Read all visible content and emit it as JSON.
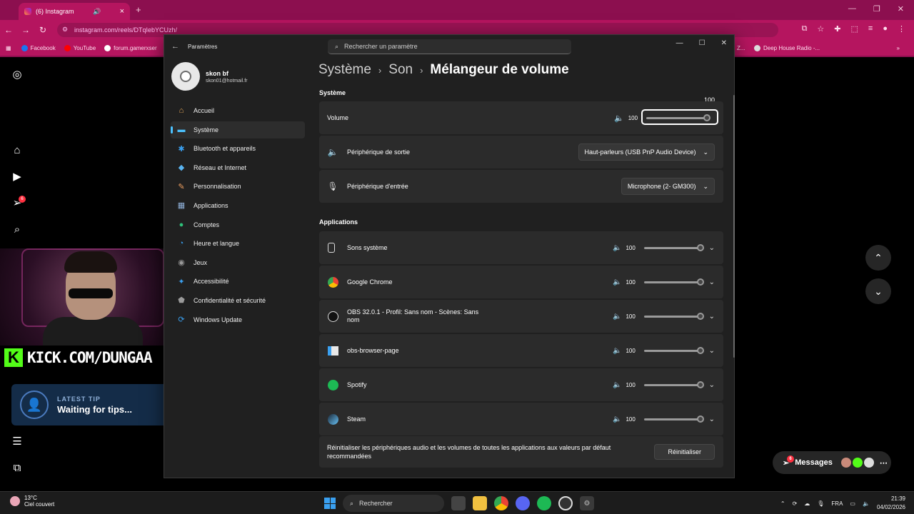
{
  "browser": {
    "tab_title": "(6) Instagram",
    "new_tab": "+",
    "url": "instagram.com/reels/DTqIebYCUzh/",
    "bookmarks": [
      {
        "label": "Facebook",
        "color": "#1877f2"
      },
      {
        "label": "YouTube",
        "color": "#ff0000"
      },
      {
        "label": "forum.gamerxser",
        "color": "#ffffff"
      }
    ],
    "bookmark_right": "Deep House Radio -...",
    "bookmark_z": "Z...",
    "overflow": "»"
  },
  "instagram": {
    "notif_count": "6",
    "messages_label": "Messages",
    "messages_count": "6"
  },
  "overlay": {
    "kick_logo": "K",
    "kick_text": "KICK.COM/DUNGAA",
    "tip_heading": "LATEST TIP",
    "tip_text": "Waiting for tips..."
  },
  "settings": {
    "app_title": "Paramètres",
    "search_placeholder": "Rechercher un paramètre",
    "user_name": "skon bf",
    "user_email": "skon01@hotmail.fr",
    "nav": [
      {
        "label": "Accueil",
        "icon": "home-icon",
        "glyph": "⌂",
        "color": "#e8a95a"
      },
      {
        "label": "Système",
        "icon": "system-icon",
        "glyph": "▬",
        "color": "#4cc2ff",
        "active": true
      },
      {
        "label": "Bluetooth et appareils",
        "icon": "bluetooth-icon",
        "glyph": "✱",
        "color": "#3aa0f0"
      },
      {
        "label": "Réseau et Internet",
        "icon": "network-icon",
        "glyph": "◆",
        "color": "#5ab4f0"
      },
      {
        "label": "Personnalisation",
        "icon": "brush-icon",
        "glyph": "✎",
        "color": "#f0a060"
      },
      {
        "label": "Applications",
        "icon": "apps-icon",
        "glyph": "▦",
        "color": "#8fb0d8"
      },
      {
        "label": "Comptes",
        "icon": "accounts-icon",
        "glyph": "●",
        "color": "#2fc07a"
      },
      {
        "label": "Heure et langue",
        "icon": "time-language-icon",
        "glyph": "◔",
        "color": "#3aa0f0"
      },
      {
        "label": "Jeux",
        "icon": "gaming-icon",
        "glyph": "◉",
        "color": "#999999"
      },
      {
        "label": "Accessibilité",
        "icon": "accessibility-icon",
        "glyph": "✦",
        "color": "#3aa0f0"
      },
      {
        "label": "Confidentialité et sécurité",
        "icon": "shield-icon",
        "glyph": "⬟",
        "color": "#9a9a9a"
      },
      {
        "label": "Windows Update",
        "icon": "update-icon",
        "glyph": "⟳",
        "color": "#3aa0f0"
      }
    ],
    "breadcrumb": [
      "Système",
      "Son",
      "Mélangeur de volume"
    ],
    "section_system": "Système",
    "volume": {
      "label": "Volume",
      "value": "100",
      "tooltip": "100",
      "level": 1.0
    },
    "output": {
      "label": "Périphérique de sortie",
      "selected": "Haut-parleurs (USB PnP Audio Device)"
    },
    "input": {
      "label": "Périphérique d'entrée",
      "selected": "Microphone (2- GM300)"
    },
    "section_apps": "Applications",
    "apps": [
      {
        "label": "Sons système",
        "value": "100",
        "level": 1.0
      },
      {
        "label": "Google Chrome",
        "value": "100",
        "level": 1.0
      },
      {
        "label": "OBS 32.0.1 - Profil: Sans nom - Scènes: Sans nom",
        "value": "100",
        "level": 1.0
      },
      {
        "label": "obs-browser-page",
        "value": "100",
        "level": 1.0
      },
      {
        "label": "Spotify",
        "value": "100",
        "level": 1.0
      },
      {
        "label": "Steam",
        "value": "100",
        "level": 1.0
      }
    ],
    "reset_text": "Réinitialiser les périphériques audio et les volumes de toutes les applications aux valeurs par défaut recommandées",
    "reset_button": "Réinitialiser"
  },
  "taskbar": {
    "temp": "13°C",
    "weather": "Ciel couvert",
    "search": "Rechercher",
    "lang": "FRA",
    "time": "21:39",
    "date": "04/02/2026"
  }
}
